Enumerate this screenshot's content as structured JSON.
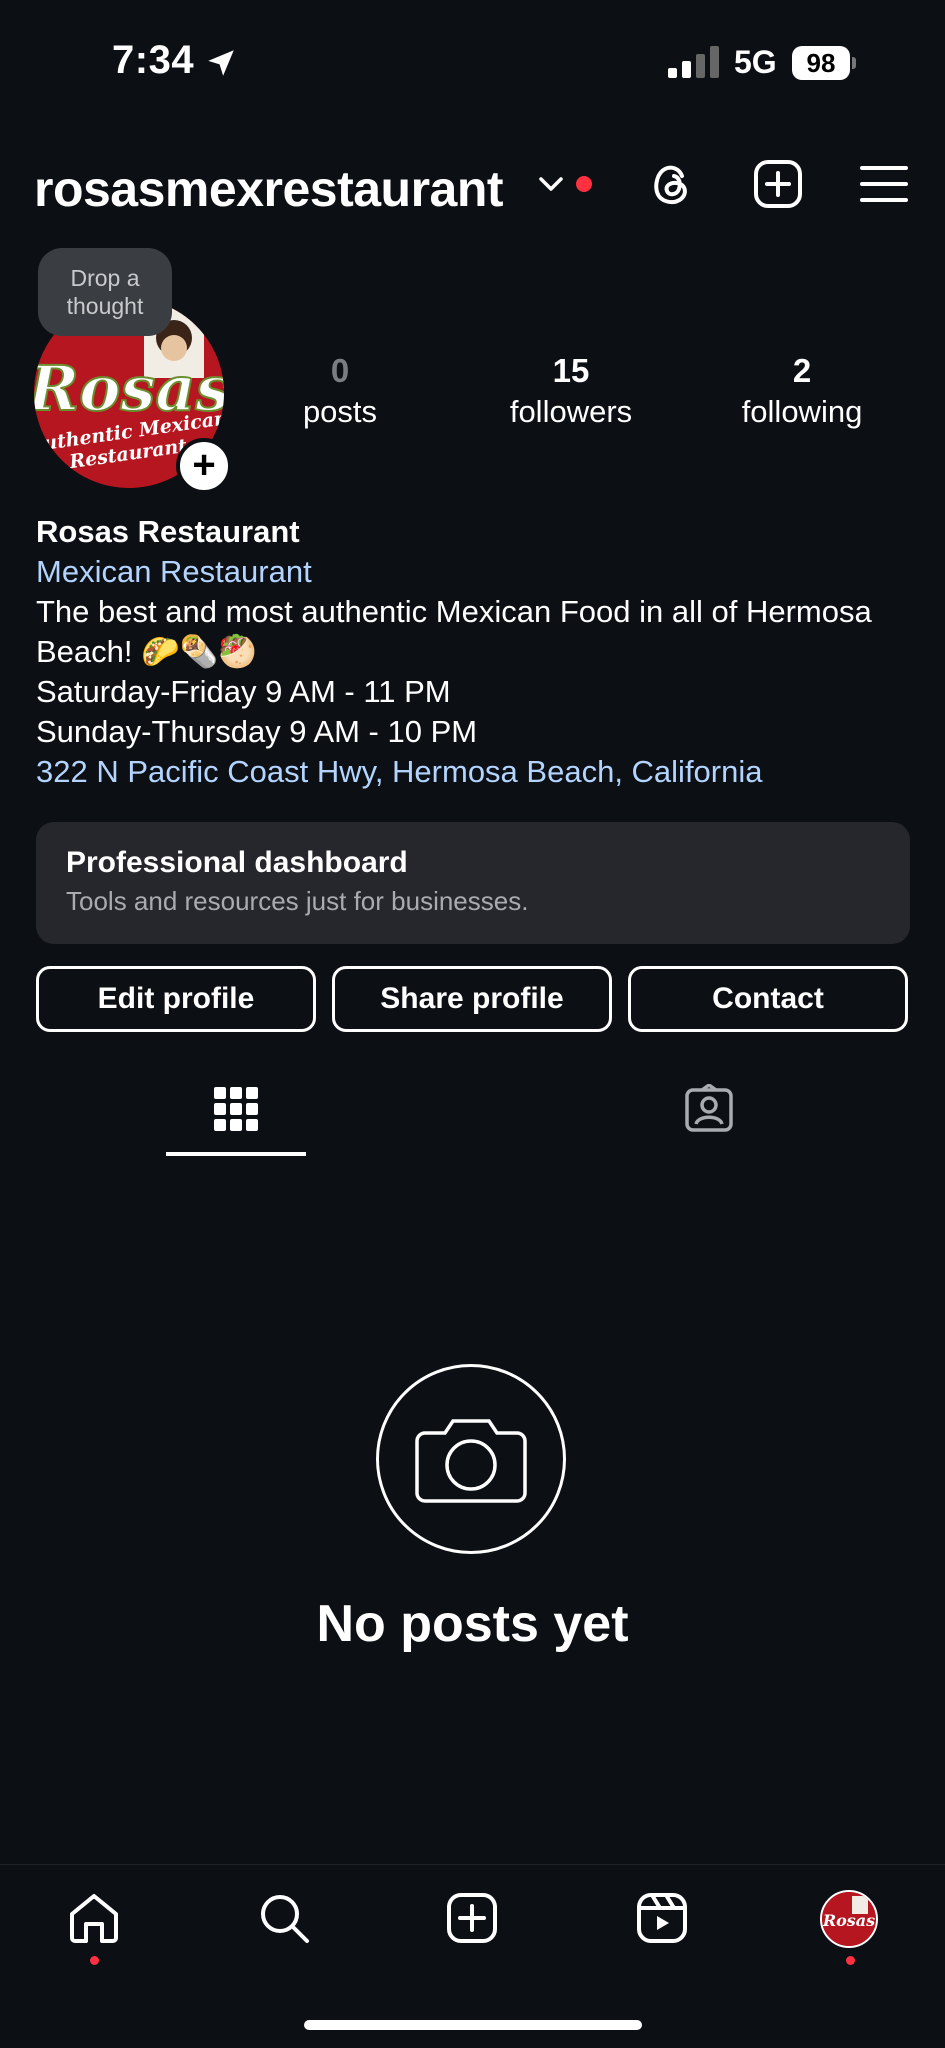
{
  "status_bar": {
    "time": "7:34",
    "network": "5G",
    "battery": "98"
  },
  "header": {
    "username": "rosasmexrestaurant"
  },
  "note": {
    "text_line1": "Drop a",
    "text_line2": "thought"
  },
  "avatar": {
    "logo_text": "Rosas",
    "logo_subtext": "Authentic Mexican Restaurant"
  },
  "stats": {
    "posts_count": "0",
    "posts_label": "posts",
    "followers_count": "15",
    "followers_label": "followers",
    "following_count": "2",
    "following_label": "following"
  },
  "bio": {
    "name": "Rosas Restaurant",
    "category": "Mexican Restaurant",
    "line1": "The best and most authentic Mexican Food in all of Hermosa",
    "line2": "Beach! 🌮🌯🥙",
    "hours1": "Saturday-Friday 9 AM - 11 PM",
    "hours2": "Sunday-Thursday 9 AM - 10 PM",
    "address": "322 N Pacific Coast Hwy, Hermosa Beach, California"
  },
  "dashboard": {
    "title": "Professional dashboard",
    "subtitle": "Tools and resources just for businesses."
  },
  "buttons": {
    "edit": "Edit profile",
    "share": "Share profile",
    "contact": "Contact"
  },
  "empty_state": {
    "text": "No posts yet"
  },
  "colors": {
    "background": "#0c0f14",
    "link": "#b3d4ff",
    "notification": "#ff3040",
    "card": "#25272c"
  }
}
